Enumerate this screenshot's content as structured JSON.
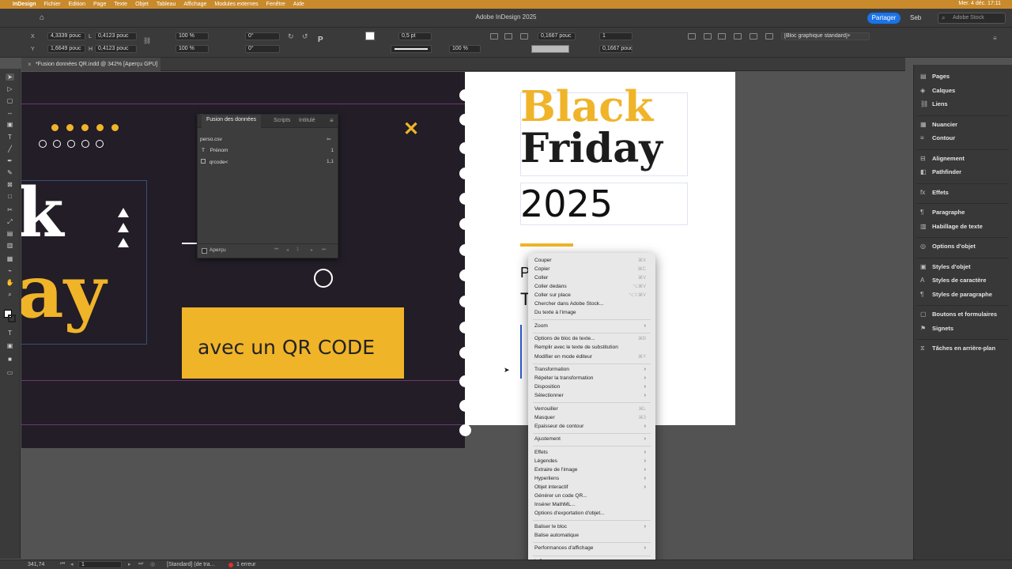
{
  "menubar": {
    "apple": "",
    "items": [
      "InDesign",
      "Fichier",
      "Edition",
      "Page",
      "Texte",
      "Objet",
      "Tableau",
      "Affichage",
      "Modules externes",
      "Fenêtre",
      "Aide"
    ],
    "clock": "Mer. 4 déc. 17:11"
  },
  "titlebar": {
    "title": "Adobe InDesign 2025",
    "share": "Partager",
    "user": "Seb",
    "stock_placeholder": "Adobe Stock"
  },
  "control": {
    "x_label": "X",
    "y_label": "Y",
    "w_label": "L",
    "h_label": "H",
    "x": "4,3339 pouc",
    "y": "1,6649 pouc",
    "w": "0,4123 pouc",
    "h": "0,4123 pouc",
    "scale_x": "100 %",
    "scale_y": "100 %",
    "rotation": "0°",
    "shear": "0°",
    "stroke_weight": "0,5 pt",
    "opacity": "100 %",
    "fit_w": "0,1667 pouc",
    "fit_h": "0,1667 pouc",
    "columns": "1",
    "style": "[Bloc graphique standard]+"
  },
  "doc_tab": "*Fusion données QR.indd @ 342% [Aperçu GPU]",
  "spread": {
    "left_big_1": "k",
    "left_big_2": "ay",
    "banner_text": "avec un QR CODE",
    "x_mark": "✕",
    "title_line_1": "Black",
    "title_line_2": "Friday",
    "year": "2025",
    "partial_p": "P",
    "partial_t": "T"
  },
  "merge_panel": {
    "tabs": [
      "Fusion des données",
      "Scripts",
      "Intitulé"
    ],
    "source": "perso.csv",
    "fields": [
      {
        "type": "T",
        "name": "Prénom",
        "value": "1"
      },
      {
        "type": "img",
        "name": "qrcode<",
        "value": "1,1"
      }
    ],
    "preview_label": "Aperçu",
    "record": "1"
  },
  "context_menu": [
    {
      "label": "Couper",
      "shortcut": "⌘X"
    },
    {
      "label": "Copier",
      "shortcut": "⌘C"
    },
    {
      "label": "Coller",
      "shortcut": "⌘V"
    },
    {
      "label": "Coller dedans",
      "shortcut": "⌥⌘V"
    },
    {
      "label": "Coller sur place",
      "shortcut": "⌥⇧⌘V"
    },
    {
      "label": "Chercher dans Adobe Stock..."
    },
    {
      "label": "Du texte à l'image"
    },
    {
      "sep": true
    },
    {
      "label": "Zoom",
      "sub": true
    },
    {
      "sep": true
    },
    {
      "label": "Options de bloc de texte...",
      "shortcut": "⌘B"
    },
    {
      "label": "Remplir avec le texte de substitution"
    },
    {
      "label": "Modifier en mode éditeur",
      "shortcut": "⌘Y"
    },
    {
      "sep": true
    },
    {
      "label": "Transformation",
      "sub": true
    },
    {
      "label": "Répéter la transformation",
      "sub": true
    },
    {
      "label": "Disposition",
      "sub": true
    },
    {
      "label": "Sélectionner",
      "sub": true
    },
    {
      "sep": true
    },
    {
      "label": "Verrouiller",
      "shortcut": "⌘L"
    },
    {
      "label": "Masquer",
      "shortcut": "⌘3"
    },
    {
      "label": "Epaisseur de contour",
      "sub": true
    },
    {
      "sep": true
    },
    {
      "label": "Ajustement",
      "sub": true
    },
    {
      "sep": true
    },
    {
      "label": "Effets",
      "sub": true
    },
    {
      "label": "Légendes",
      "sub": true
    },
    {
      "label": "Extraire de l'image",
      "sub": true
    },
    {
      "label": "Hyperliens",
      "sub": true
    },
    {
      "label": "Objet interactif",
      "sub": true
    },
    {
      "label": "Générer un code QR..."
    },
    {
      "label": "Insérer MathML..."
    },
    {
      "label": "Options d'exportation d'objet..."
    },
    {
      "sep": true
    },
    {
      "label": "Baliser le bloc",
      "sub": true
    },
    {
      "label": "Balise automatique"
    },
    {
      "sep": true
    },
    {
      "label": "Performances d'affichage",
      "sub": true
    },
    {
      "sep": true
    },
    {
      "label": "InCopy",
      "sub": true
    }
  ],
  "right_panels": [
    {
      "label": "Pages",
      "icon": "pages-icon"
    },
    {
      "label": "Calques",
      "icon": "layers-icon"
    },
    {
      "label": "Liens",
      "icon": "links-icon"
    },
    {
      "sep": true
    },
    {
      "label": "Nuancier",
      "icon": "swatches-icon"
    },
    {
      "label": "Contour",
      "icon": "stroke-icon"
    },
    {
      "sep": true
    },
    {
      "label": "Alignement",
      "icon": "align-icon"
    },
    {
      "label": "Pathfinder",
      "icon": "pathfinder-icon"
    },
    {
      "sep": true
    },
    {
      "label": "Effets",
      "icon": "effects-icon"
    },
    {
      "sep": true
    },
    {
      "label": "Paragraphe",
      "icon": "paragraph-icon"
    },
    {
      "label": "Habillage de texte",
      "icon": "text-wrap-icon"
    },
    {
      "sep": true
    },
    {
      "label": "Options d'objet",
      "icon": "object-options-icon"
    },
    {
      "sep": true
    },
    {
      "label": "Styles d'objet",
      "icon": "object-styles-icon"
    },
    {
      "label": "Styles de caractère",
      "icon": "character-styles-icon"
    },
    {
      "label": "Styles de paragraphe",
      "icon": "paragraph-styles-icon"
    },
    {
      "sep": true
    },
    {
      "label": "Boutons et formulaires",
      "icon": "buttons-icon"
    },
    {
      "label": "Signets",
      "icon": "bookmarks-icon"
    },
    {
      "sep": true
    },
    {
      "label": "Tâches en arrière-plan",
      "icon": "background-tasks-icon"
    }
  ],
  "status": {
    "zoom": "341,74",
    "page": "1",
    "preflight_profile": "[Standard] (de tra...",
    "errors": "1 erreur"
  },
  "colors": {
    "accent_yellow": "#f0b429",
    "dark_page": "#221d26",
    "menubar": "#c98a2c",
    "error_red": "#e03030"
  }
}
